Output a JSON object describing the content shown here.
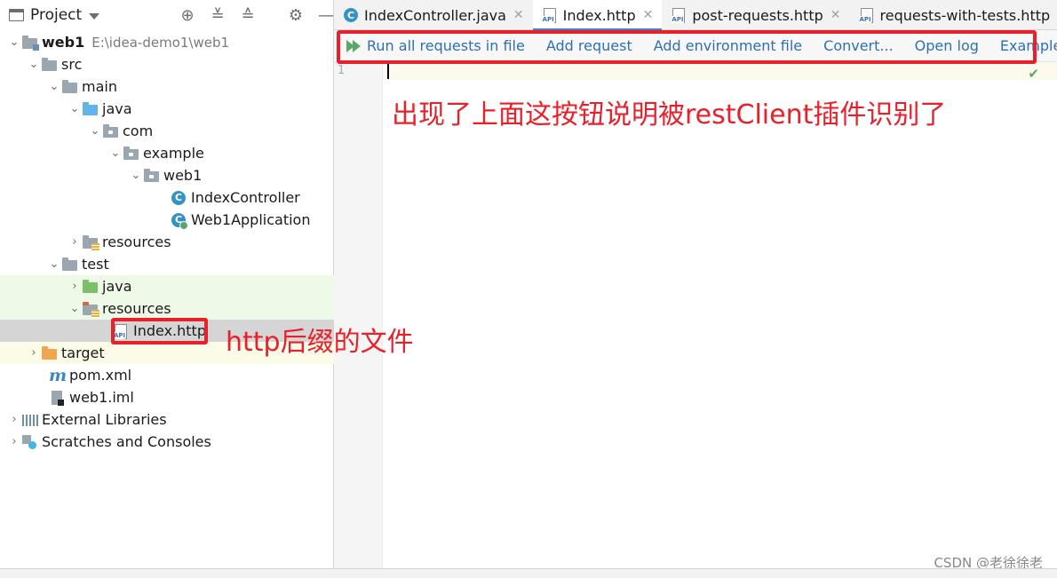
{
  "project_panel": {
    "title": "Project",
    "tree": [
      {
        "label": "web1",
        "path": "E:\\idea-demo1\\web1"
      },
      {
        "label": "src"
      },
      {
        "label": "main"
      },
      {
        "label": "java"
      },
      {
        "label": "com"
      },
      {
        "label": "example"
      },
      {
        "label": "web1"
      },
      {
        "label": "IndexController"
      },
      {
        "label": "Web1Application"
      },
      {
        "label": "resources"
      },
      {
        "label": "test"
      },
      {
        "label": "java"
      },
      {
        "label": "resources"
      },
      {
        "label": "Index.http"
      },
      {
        "label": "target"
      },
      {
        "label": "pom.xml"
      },
      {
        "label": "web1.iml"
      },
      {
        "label": "External Libraries"
      },
      {
        "label": "Scratches and Consoles"
      }
    ]
  },
  "tabs": [
    {
      "label": "IndexController.java",
      "icon": "class-icon"
    },
    {
      "label": "Index.http",
      "icon": "http-file-icon",
      "active": true
    },
    {
      "label": "post-requests.http",
      "icon": "http-file-icon"
    },
    {
      "label": "requests-with-tests.http",
      "icon": "http-file-icon"
    }
  ],
  "http_toolbar": {
    "run_all": "Run all requests in file",
    "add_request": "Add request",
    "add_env": "Add environment file",
    "convert": "Convert...",
    "open_log": "Open log",
    "examples": "Examples"
  },
  "editor": {
    "line_number": "1"
  },
  "annotations": {
    "toolbar_note": "出现了上面这按钮说明被restClient插件识别了",
    "file_note": "http后缀的文件",
    "color": "#e8202a"
  },
  "watermark": "CSDN @老徐徐老"
}
